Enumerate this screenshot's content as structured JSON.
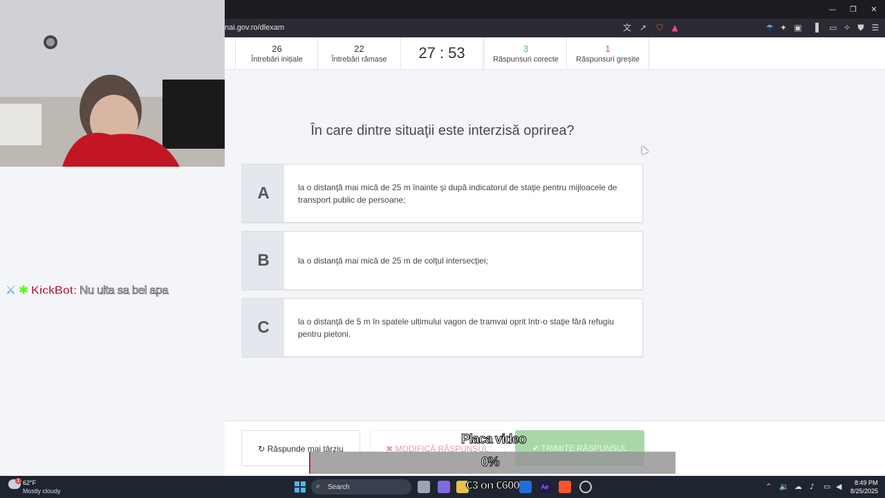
{
  "browser": {
    "url": "nai.gov.ro/dlexam",
    "window_controls": [
      "—",
      "❐",
      "✕"
    ]
  },
  "stats": {
    "initial": {
      "value": "26",
      "label": "Întrebări inițiale"
    },
    "remaining": {
      "value": "22",
      "label": "Întrebări rămase"
    },
    "timer": "27 : 53",
    "correct": {
      "value": "3",
      "label": "Răspunsuri corecte",
      "color": "#5cb85c"
    },
    "wrong": {
      "value": "1",
      "label": "Răspunsuri greșite",
      "color": "#d9534f"
    }
  },
  "question": {
    "text": "În care dintre situaţii este interzisă oprirea?",
    "answers": [
      {
        "letter": "A",
        "text": "la o distanţă mai mică de 25 m înainte şi după indicatorul de staţie pentru mijloacele de transport public de persoane;"
      },
      {
        "letter": "B",
        "text": "la o distanţă mai mică de 25 m de colţul intersecţiei;"
      },
      {
        "letter": "C",
        "text": "la o distanţă de 5 m în spatele ultimului vagon de tramvai oprit într-o staţie fără refugiu pentru pietoni."
      }
    ]
  },
  "footer": {
    "later_label": "Răspunde mai târziu",
    "modify_label": "MODIFICĂ RĂSPUNSUL",
    "send_label": "TRIMITE RĂSPUNSUL"
  },
  "overlay": {
    "chat_name": "KickBot:",
    "chat_message": "Nu uita sa bei apa",
    "video_title": "Placa video",
    "video_progress": "0%",
    "promo_text": "€3 on €600"
  },
  "taskbar": {
    "weather_temp": "62°F",
    "weather_desc": "Mostly cloudy",
    "search_label": "Search",
    "time": "8:49 PM",
    "date": "8/25/2025",
    "weather_badge": "1"
  },
  "colors": {
    "correct": "#5cb85c",
    "wrong": "#d9534f",
    "send_button": "#a9d8a8"
  },
  "icons": [
    "translate-icon",
    "share-icon",
    "brave-shield-icon",
    "brave-rewards-icon",
    "extensions-icon",
    "sidebar-icon",
    "wallet-icon",
    "leo-icon",
    "vpn-icon",
    "menu-icon",
    "refresh-icon",
    "windows-start-icon",
    "search-icon"
  ]
}
